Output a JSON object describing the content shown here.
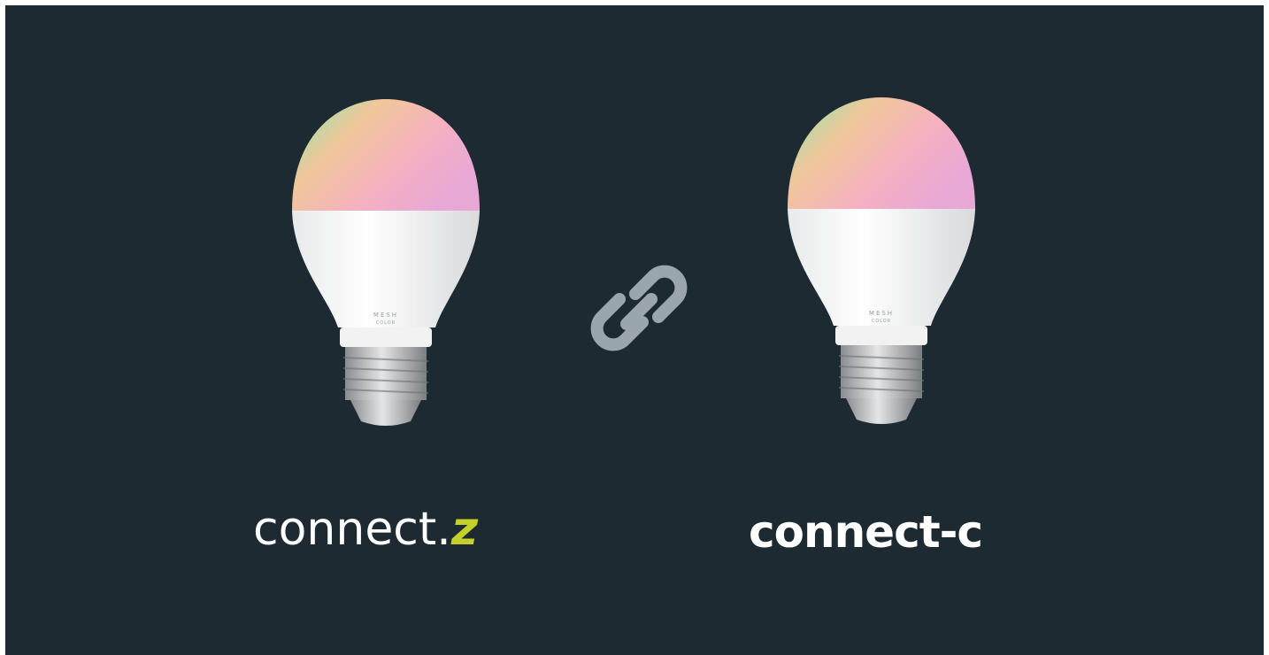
{
  "products": [
    {
      "bulb_label": "MESH",
      "bulb_sublabel": "COLOR",
      "logo_main": "connect.",
      "logo_accent": "z"
    },
    {
      "bulb_label": "MESH",
      "bulb_sublabel": "COLOR",
      "logo_main": "connect-c"
    }
  ],
  "link_icon": "chain-link-icon",
  "colors": {
    "background": "#1d2a32",
    "accent": "#c3d12a",
    "icon": "#9aa5ad"
  }
}
